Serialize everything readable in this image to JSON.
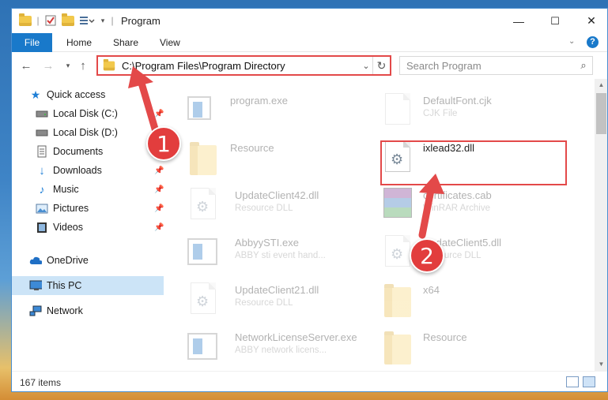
{
  "window": {
    "title": "Program",
    "controls": {
      "minimize": "—",
      "maximize": "☐",
      "close": "✕"
    }
  },
  "ribbon": {
    "tabs": [
      "File",
      "Home",
      "Share",
      "View"
    ]
  },
  "address_bar": {
    "path": "C:\\Program Files\\Program Directory"
  },
  "search": {
    "placeholder": "Search Program"
  },
  "sidebar": {
    "items": [
      {
        "label": "Quick access",
        "icon": "star-icon",
        "pinned": false
      },
      {
        "label": "Local Disk (C:)",
        "icon": "drive-icon",
        "pinned": true
      },
      {
        "label": "Local Disk (D:)",
        "icon": "drive-icon",
        "pinned": false
      },
      {
        "label": "Documents",
        "icon": "documents-icon",
        "pinned": false
      },
      {
        "label": "Downloads",
        "icon": "download-icon",
        "pinned": true
      },
      {
        "label": "Music",
        "icon": "music-icon",
        "pinned": true
      },
      {
        "label": "Pictures",
        "icon": "pictures-icon",
        "pinned": true
      },
      {
        "label": "Videos",
        "icon": "videos-icon",
        "pinned": true
      },
      {
        "label": "OneDrive",
        "icon": "cloud-icon",
        "pinned": false
      },
      {
        "label": "This PC",
        "icon": "computer-icon",
        "pinned": false,
        "selected": true
      },
      {
        "label": "Network",
        "icon": "network-icon",
        "pinned": false
      }
    ]
  },
  "files": [
    {
      "name": "program.exe",
      "type": "",
      "icon": "exe-icon"
    },
    {
      "name": "DefaultFont.cjk",
      "type": "CJK File",
      "icon": "document-icon"
    },
    {
      "name": "Resource",
      "type": "",
      "icon": "folder-icon"
    },
    {
      "name": "ixlead32.dll",
      "type": "",
      "icon": "dll-gear-icon",
      "highlighted": true
    },
    {
      "name": "UpdateClient42.dll",
      "type": "Resource DLL",
      "icon": "dll-gear-icon"
    },
    {
      "name": "certificates.cab",
      "type": "WinRAR Archive",
      "icon": "winrar-icon"
    },
    {
      "name": "AbbyySTI.exe",
      "type": "ABBY sti event hand...",
      "icon": "exe-icon"
    },
    {
      "name": "UpdateClient5.dll",
      "type": "Resource DLL",
      "icon": "dll-gear-icon"
    },
    {
      "name": "UpdateClient21.dll",
      "type": "Resource DLL",
      "icon": "dll-gear-icon"
    },
    {
      "name": "x64",
      "type": "",
      "icon": "folder-icon"
    },
    {
      "name": "NetworkLicenseServer.exe",
      "type": "ABBY network licens...",
      "icon": "exe-icon"
    },
    {
      "name": "Resource",
      "type": "",
      "icon": "folder-icon"
    }
  ],
  "status": {
    "item_count": "167 items"
  },
  "annotations": {
    "step1": "1",
    "step2": "2",
    "accent": "#e34949"
  }
}
